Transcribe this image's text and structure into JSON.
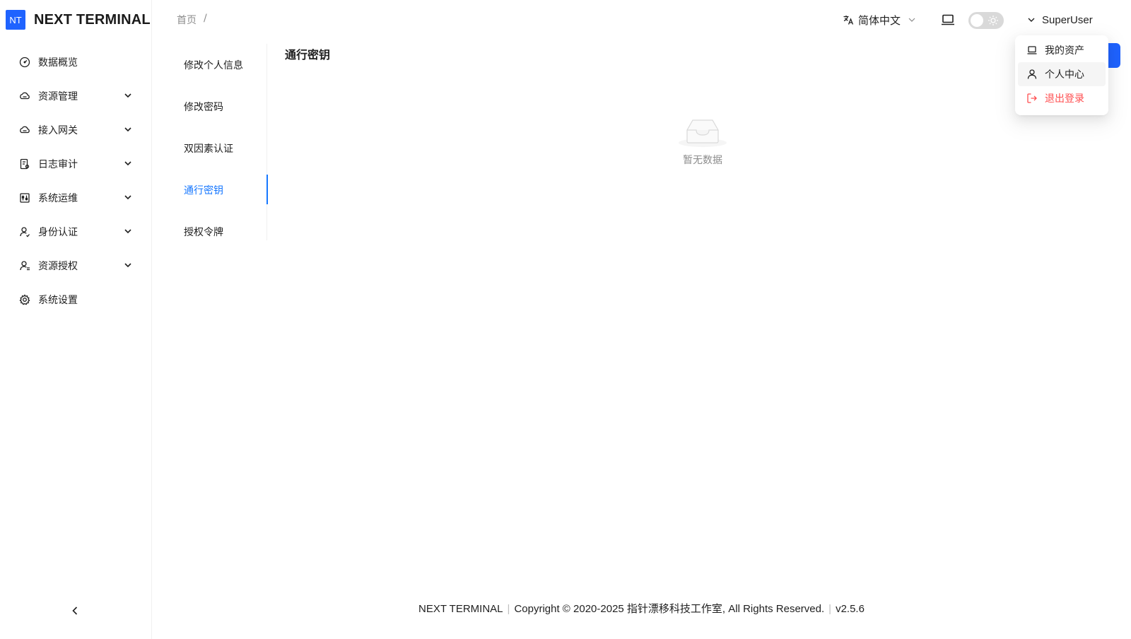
{
  "brand": {
    "logo_text": "NT",
    "name": "NEXT TERMINAL"
  },
  "sidebar": {
    "items": [
      {
        "label": "数据概览",
        "icon": "dashboard-icon",
        "has_children": false
      },
      {
        "label": "资源管理",
        "icon": "cloud-icon",
        "has_children": true
      },
      {
        "label": "接入网关",
        "icon": "cloud-icon",
        "has_children": true
      },
      {
        "label": "日志审计",
        "icon": "audit-icon",
        "has_children": true
      },
      {
        "label": "系统运维",
        "icon": "control-icon",
        "has_children": true
      },
      {
        "label": "身份认证",
        "icon": "user-icon",
        "has_children": true
      },
      {
        "label": "资源授权",
        "icon": "user-auth-icon",
        "has_children": true
      },
      {
        "label": "系统设置",
        "icon": "gear-icon",
        "has_children": false
      }
    ]
  },
  "header": {
    "breadcrumb": [
      "首页",
      "/"
    ],
    "language": "简体中文",
    "user": "SuperUser"
  },
  "subnav": {
    "items": [
      {
        "label": "修改个人信息"
      },
      {
        "label": "修改密码"
      },
      {
        "label": "双因素认证"
      },
      {
        "label": "通行密钥"
      },
      {
        "label": "授权令牌"
      }
    ],
    "active_index": 3
  },
  "content": {
    "title": "通行密钥",
    "empty_text": "暂无数据"
  },
  "dropdown": {
    "items": [
      {
        "label": "我的资产",
        "icon": "laptop-icon"
      },
      {
        "label": "个人中心",
        "icon": "user-icon"
      },
      {
        "label": "退出登录",
        "icon": "logout-icon"
      }
    ]
  },
  "footer": {
    "product": "NEXT TERMINAL",
    "copyright": "Copyright © 2020-2025 指针漂移科技工作室, All Rights Reserved.",
    "version": "v2.5.6"
  },
  "colors": {
    "primary": "#1677ff",
    "brand": "#1f63ff",
    "danger": "#ff4d4f"
  }
}
